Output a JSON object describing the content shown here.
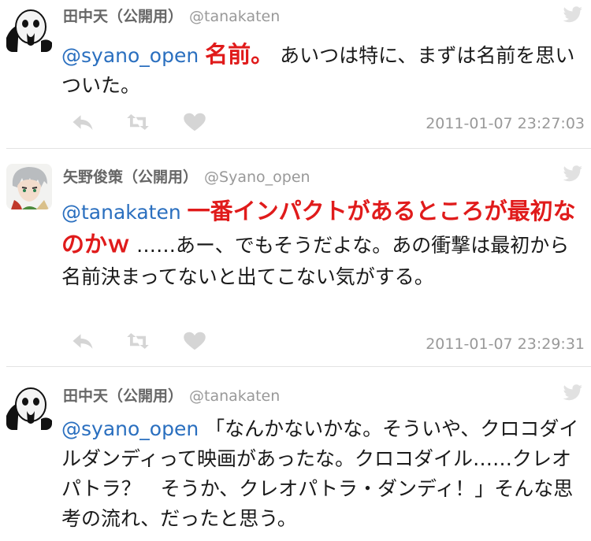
{
  "tweets": [
    {
      "name": "田中天（公開用）",
      "handle": "@tanakaten",
      "mention": "@syano_open",
      "highlight": "名前。",
      "text": "あいつは特に、まずは名前を思いついた。",
      "timestamp": "2011-01-07 23:27:03"
    },
    {
      "name": "矢野俊策（公開用）",
      "handle": "@Syano_open",
      "mention": "@tanakaten",
      "highlight": "一番インパクトがあるところが最初なのかｗ",
      "text": "……あー、でもそうだよな。あの衝撃は最初から名前決まってないと出てこない気がする。",
      "timestamp": "2011-01-07 23:29:31"
    },
    {
      "name": "田中天（公開用）",
      "handle": "@tanakaten",
      "mention": "@syano_open",
      "text": "「なんかないかな。そういや、クロコダイルダンディって映画があったな。クロコダイル……クレオパトラ？　そうか、クレオパトラ・ダンディ！」そんな思考の流れ、だったと思う。"
    }
  ],
  "icons": [
    "reply-icon",
    "retweet-icon",
    "heart-icon",
    "twitter-bird-icon"
  ],
  "colors": {
    "mention": "#2a6fbf",
    "highlight": "#e01b1b",
    "meta": "#999999"
  }
}
